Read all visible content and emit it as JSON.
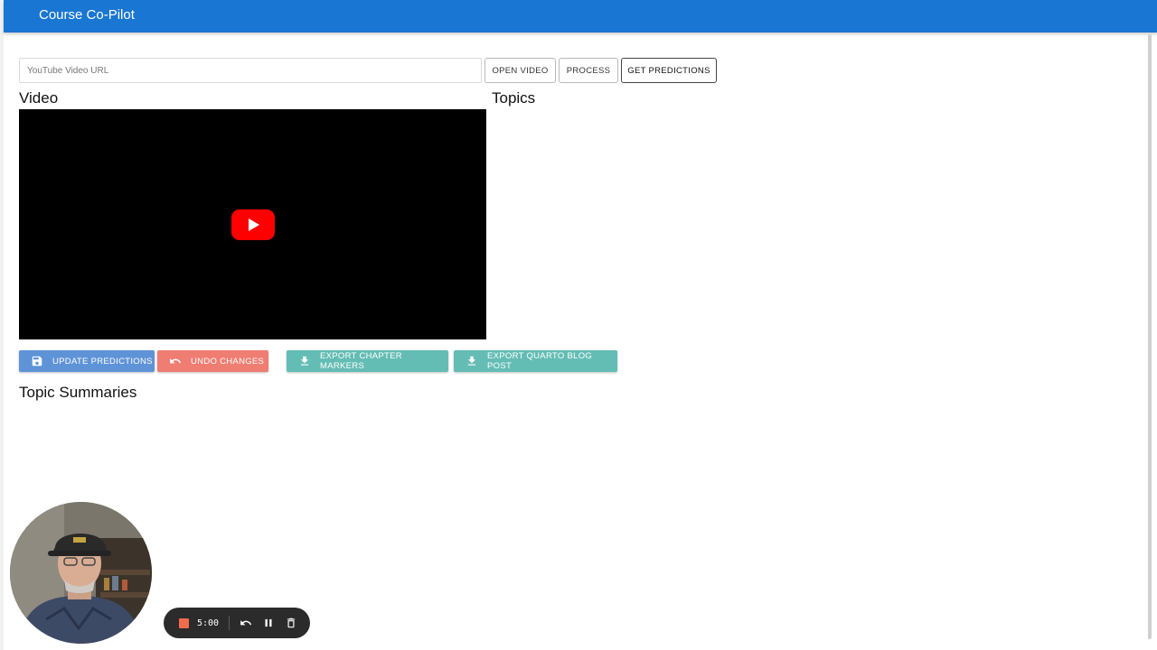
{
  "app": {
    "title": "Course Co-Pilot"
  },
  "toolbar": {
    "url_placeholder": "YouTube Video URL",
    "url_value": "",
    "open_video": "OPEN VIDEO",
    "process": "PROCESS",
    "get_predictions": "GET PREDICTIONS"
  },
  "sections": {
    "video": "Video",
    "topics": "Topics",
    "topic_summaries": "Topic Summaries"
  },
  "actions": {
    "update_predictions": "UPDATE PREDICTIONS",
    "undo_changes": "UNDO CHANGES",
    "export_chapter_markers": "EXPORT CHAPTER MARKERS",
    "export_quarto_blog_post": "EXPORT QUARTO BLOG POST"
  },
  "recorder": {
    "time": "5:00"
  },
  "colors": {
    "appbar": "#1976d2",
    "update": "#5f93d8",
    "undo": "#ef7d72",
    "export": "#64bdb4",
    "youtube_red": "#ff0000",
    "recorder_bg": "#2b2b2b",
    "record_stop": "#f26b4d"
  },
  "icons": {
    "update": "save-icon",
    "undo": "undo-icon",
    "export": "download-icon",
    "video_play": "youtube-play-icon"
  }
}
